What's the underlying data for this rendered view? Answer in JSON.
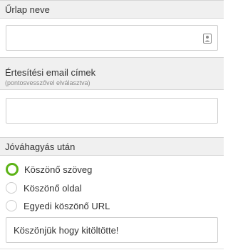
{
  "form_name_section": {
    "title": "Űrlap neve",
    "input_value": "",
    "icon": "contact-card-icon"
  },
  "notification_section": {
    "title": "Értesítési email címek",
    "subtitle": "(pontosvesszővel elválasztva)",
    "input_value": ""
  },
  "after_approval_section": {
    "title": "Jóváhagyás után",
    "options": [
      {
        "label": "Köszönő szöveg",
        "selected": true
      },
      {
        "label": "Köszönő oldal",
        "selected": false
      },
      {
        "label": "Egyedi köszönő URL",
        "selected": false
      }
    ],
    "thank_you_text": "Köszönjük hogy kitöltötte!"
  },
  "colors": {
    "header_bg": "#f0f0f0",
    "accent_green": "#5cb317",
    "border": "#cfcfcf"
  }
}
